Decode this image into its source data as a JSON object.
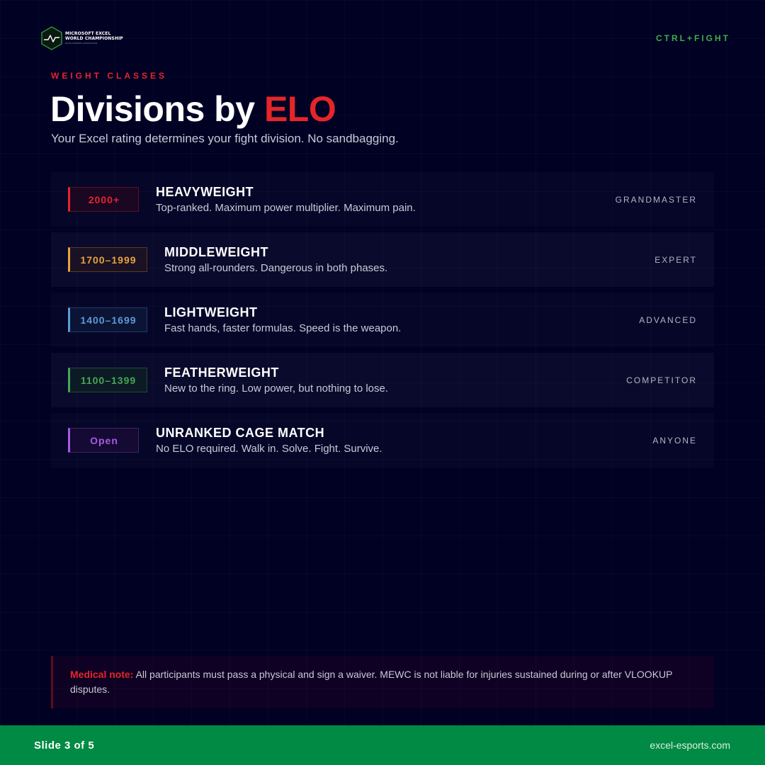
{
  "header": {
    "logo_line1": "MICROSOFT EXCEL",
    "logo_line2": "WORLD CHAMPIONSHIP",
    "logo_sub": "EXCEL ESPORTS ASSOCIATION",
    "tag": "CTRL+FIGHT"
  },
  "intro": {
    "eyebrow": "WEIGHT CLASSES",
    "title_main": "Divisions by ",
    "title_accent": "ELO",
    "subtitle": "Your Excel rating determines your fight division. No sandbagging."
  },
  "divisions": [
    {
      "range": "2000+",
      "name": "HEAVYWEIGHT",
      "description": "Top-ranked. Maximum power multiplier. Maximum pain.",
      "level": "GRANDMASTER",
      "color": "#e5252a",
      "badge_bg": "#1a0722",
      "badge_border": "#5a1420"
    },
    {
      "range": "1700–1999",
      "name": "MIDDLEWEIGHT",
      "description": "Strong all-rounders. Dangerous in both phases.",
      "level": "EXPERT",
      "color": "#e8a33d",
      "badge_bg": "#1a1224",
      "badge_border": "#5a3a1c"
    },
    {
      "range": "1400–1699",
      "name": "LIGHTWEIGHT",
      "description": "Fast hands, faster formulas. Speed is the weapon.",
      "level": "ADVANCED",
      "color": "#5b9bd9",
      "badge_bg": "#0c1436",
      "badge_border": "#233a66"
    },
    {
      "range": "1100–1399",
      "name": "FEATHERWEIGHT",
      "description": "New to the ring. Low power, but nothing to lose.",
      "level": "COMPETITOR",
      "color": "#47a854",
      "badge_bg": "#0c1a26",
      "badge_border": "#1e4a32"
    },
    {
      "range": "Open",
      "name": "UNRANKED CAGE MATCH",
      "description": "No ELO required. Walk in. Solve. Fight. Survive.",
      "level": "ANYONE",
      "color": "#a85be0",
      "badge_bg": "#140a34",
      "badge_border": "#3e2464"
    }
  ],
  "note": {
    "label": "Medical note:",
    "text": " All participants must pass a physical and sign a waiver. MEWC is not liable for injuries sustained during or after VLOOKUP disputes."
  },
  "footer": {
    "slide": "Slide 3 of 5",
    "site": "excel-esports.com"
  }
}
